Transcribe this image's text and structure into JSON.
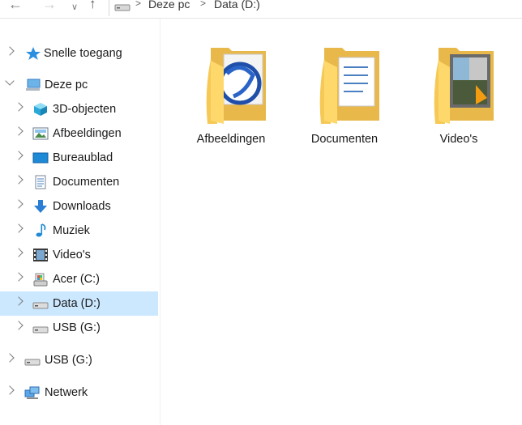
{
  "address": {
    "crumbs": [
      "Deze pc",
      "Data (D:)"
    ]
  },
  "nav": {
    "quick_access": "Snelle toegang",
    "this_pc": "Deze pc",
    "pc_items": [
      "3D-objecten",
      "Afbeeldingen",
      "Bureaublad",
      "Documenten",
      "Downloads",
      "Muziek",
      "Video's",
      "Acer (C:)",
      "Data (D:)",
      "USB (G:)"
    ],
    "usb": "USB (G:)",
    "network": "Netwerk",
    "selected": "Data (D:)"
  },
  "folders": [
    {
      "label": "Afbeeldingen",
      "icon": "folder-pictures-icon"
    },
    {
      "label": "Documenten",
      "icon": "folder-documents-icon"
    },
    {
      "label": "Video's",
      "icon": "folder-videos-icon"
    }
  ],
  "colors": {
    "selection": "#cce8ff",
    "folder_back": "#e8b84a",
    "folder_front": "#ffd86b"
  }
}
